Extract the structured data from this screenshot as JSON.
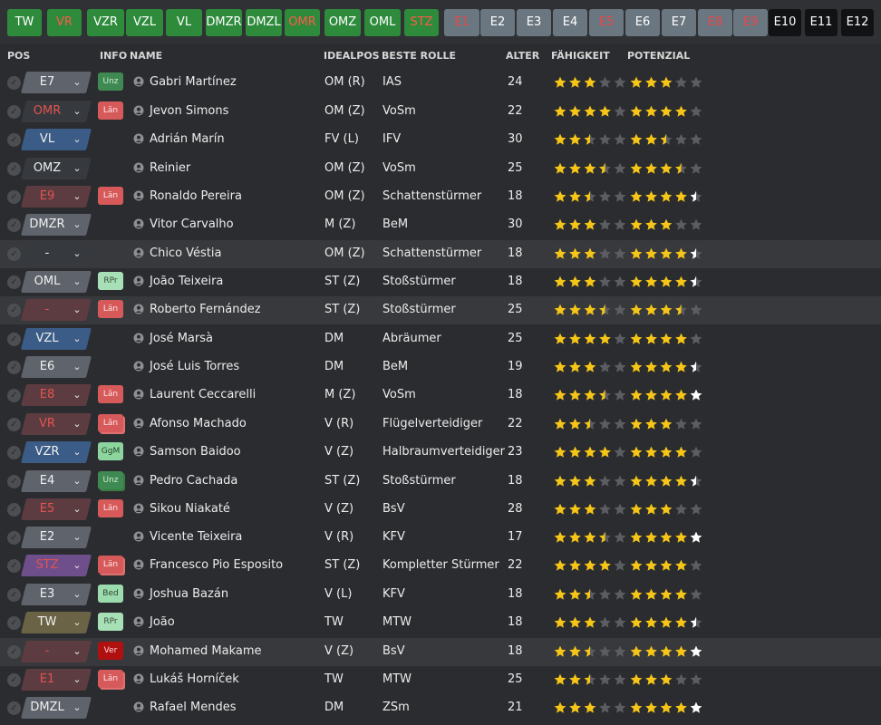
{
  "colors": {
    "star_full": "#f5c518",
    "star_white": "#ffffff",
    "star_empty": "#5b5d62"
  },
  "tabs": [
    {
      "label": "TW",
      "style": "green"
    },
    {
      "label": "VR",
      "style": "green-red"
    },
    {
      "label": "VZR",
      "style": "green"
    },
    {
      "label": "VZL",
      "style": "green"
    },
    {
      "label": "VL",
      "style": "green"
    },
    {
      "label": "DMZR",
      "style": "green"
    },
    {
      "label": "DMZL",
      "style": "green"
    },
    {
      "label": "OMR",
      "style": "green-red"
    },
    {
      "label": "OMZ",
      "style": "green"
    },
    {
      "label": "OML",
      "style": "green"
    },
    {
      "label": "STZ",
      "style": "green-red"
    },
    {
      "label": "E1",
      "style": "grey-red"
    },
    {
      "label": "E2",
      "style": "grey"
    },
    {
      "label": "E3",
      "style": "grey"
    },
    {
      "label": "E4",
      "style": "grey"
    },
    {
      "label": "E5",
      "style": "grey-red"
    },
    {
      "label": "E6",
      "style": "grey"
    },
    {
      "label": "E7",
      "style": "grey"
    },
    {
      "label": "E8",
      "style": "grey-red"
    },
    {
      "label": "E9",
      "style": "grey-red"
    },
    {
      "label": "E10",
      "style": "black"
    },
    {
      "label": "E11",
      "style": "black"
    },
    {
      "label": "E12",
      "style": "black"
    }
  ],
  "columns": {
    "pos": "POS",
    "info": "INFO",
    "name": "NAME",
    "idealpos": "IDEALPOS",
    "role": "BESTE ROLLE",
    "age": "ALTER",
    "ability": "FÄHIGKEIT",
    "potential": "POTENZIAL"
  },
  "players": [
    {
      "pos": "E7",
      "pos_style": "grey",
      "pos_red": false,
      "info": "Unz",
      "info_style": "unz",
      "name": "Gabri Martínez",
      "idealpos": "OM (R)",
      "role": "IAS",
      "age": "24",
      "ability": 3,
      "potential": 3,
      "pot_white": false
    },
    {
      "pos": "OMR",
      "pos_style": "dark",
      "pos_red": true,
      "info": "Län",
      "info_style": "lan",
      "name": "Jevon Simons",
      "idealpos": "OM (Z)",
      "role": "VoSm",
      "age": "22",
      "ability": 4,
      "potential": 4,
      "pot_white": false
    },
    {
      "pos": "VL",
      "pos_style": "blue",
      "pos_red": false,
      "info": "",
      "info_style": "",
      "name": "Adrián Marín",
      "idealpos": "FV (L)",
      "role": "IFV",
      "age": "30",
      "ability": 2.5,
      "potential": 2.5,
      "pot_white": false
    },
    {
      "pos": "OMZ",
      "pos_style": "dark",
      "pos_red": false,
      "info": "",
      "info_style": "",
      "name": "Reinier",
      "idealpos": "OM (Z)",
      "role": "VoSm",
      "age": "25",
      "ability": 3.5,
      "potential": 3.5,
      "pot_white": false
    },
    {
      "pos": "E9",
      "pos_style": "red",
      "pos_red": true,
      "info": "Län",
      "info_style": "lan",
      "name": "Ronaldo Pereira",
      "idealpos": "OM (Z)",
      "role": "Schattenstürmer",
      "age": "18",
      "ability": 2.5,
      "potential": 4.5,
      "pot_white": true
    },
    {
      "pos": "DMZR",
      "pos_style": "grey",
      "pos_red": false,
      "info": "",
      "info_style": "",
      "name": "Vitor Carvalho",
      "idealpos": "M (Z)",
      "role": "BeM",
      "age": "30",
      "ability": 3,
      "potential": 3,
      "pot_white": false
    },
    {
      "pos": "-",
      "pos_style": "dark",
      "pos_red": false,
      "info": "",
      "info_style": "",
      "name": "Chico Véstia",
      "idealpos": "OM (Z)",
      "role": "Schattenstürmer",
      "age": "18",
      "ability": 3,
      "potential": 4.5,
      "pot_white": true,
      "hl": true
    },
    {
      "pos": "OML",
      "pos_style": "grey",
      "pos_red": false,
      "info": "RPr",
      "info_style": "rpr",
      "name": "João Teixeira",
      "idealpos": "ST (Z)",
      "role": "Stoßstürmer",
      "age": "18",
      "ability": 3,
      "potential": 4.5,
      "pot_white": true
    },
    {
      "pos": "-",
      "pos_style": "red",
      "pos_red": true,
      "info": "Län",
      "info_style": "lan",
      "name": "Roberto Fernández",
      "idealpos": "ST (Z)",
      "role": "Stoßstürmer",
      "age": "25",
      "ability": 3.5,
      "potential": 3.5,
      "pot_white": false,
      "hl": true
    },
    {
      "pos": "VZL",
      "pos_style": "blue",
      "pos_red": false,
      "info": "",
      "info_style": "",
      "name": "José Marsà",
      "idealpos": "DM",
      "role": "Abräumer",
      "age": "25",
      "ability": 4,
      "potential": 4,
      "pot_white": false
    },
    {
      "pos": "E6",
      "pos_style": "grey",
      "pos_red": false,
      "info": "",
      "info_style": "",
      "name": "José Luis Torres",
      "idealpos": "DM",
      "role": "BeM",
      "age": "19",
      "ability": 3,
      "potential": 4.5,
      "pot_white": true
    },
    {
      "pos": "E8",
      "pos_style": "red",
      "pos_red": true,
      "info": "Län",
      "info_style": "lan",
      "name": "Laurent Ceccarelli",
      "idealpos": "M (Z)",
      "role": "VoSm",
      "age": "18",
      "ability": 3.5,
      "potential": 5,
      "pot_white": true
    },
    {
      "pos": "VR",
      "pos_style": "red",
      "pos_red": true,
      "info": "Län",
      "info_style": "lan-stack",
      "name": "Afonso Machado",
      "idealpos": "V (R)",
      "role": "Flügelverteidiger",
      "age": "22",
      "ability": 2.5,
      "potential": 3,
      "pot_white": false
    },
    {
      "pos": "VZR",
      "pos_style": "blue",
      "pos_red": false,
      "info": "GgM",
      "info_style": "ggm",
      "name": "Samson Baidoo",
      "idealpos": "V (Z)",
      "role": "Halbraumverteidiger",
      "age": "23",
      "ability": 4,
      "potential": 4,
      "pot_white": false
    },
    {
      "pos": "E4",
      "pos_style": "grey",
      "pos_red": false,
      "info": "Unz",
      "info_style": "unz-stack",
      "name": "Pedro Cachada",
      "idealpos": "ST (Z)",
      "role": "Stoßstürmer",
      "age": "18",
      "ability": 3,
      "potential": 4.5,
      "pot_white": true
    },
    {
      "pos": "E5",
      "pos_style": "red",
      "pos_red": true,
      "info": "Län",
      "info_style": "lan",
      "name": "Sikou Niakaté",
      "idealpos": "V (Z)",
      "role": "BsV",
      "age": "28",
      "ability": 3,
      "potential": 3,
      "pot_white": false
    },
    {
      "pos": "E2",
      "pos_style": "grey",
      "pos_red": false,
      "info": "",
      "info_style": "",
      "name": "Vicente Teixeira",
      "idealpos": "V (R)",
      "role": "KFV",
      "age": "17",
      "ability": 3.5,
      "potential": 5,
      "pot_white": true
    },
    {
      "pos": "STZ",
      "pos_style": "purple",
      "pos_red": true,
      "info": "Län",
      "info_style": "lan-stack",
      "name": "Francesco Pio Esposito",
      "idealpos": "ST (Z)",
      "role": "Kompletter Stürmer",
      "age": "22",
      "ability": 4,
      "potential": 4,
      "pot_white": false
    },
    {
      "pos": "E3",
      "pos_style": "grey",
      "pos_red": false,
      "info": "Bed",
      "info_style": "bed",
      "name": "Joshua Bazán",
      "idealpos": "V (L)",
      "role": "KFV",
      "age": "18",
      "ability": 2.5,
      "potential": 4,
      "pot_white": true
    },
    {
      "pos": "TW",
      "pos_style": "olive",
      "pos_red": false,
      "info": "RPr",
      "info_style": "rpr",
      "name": "João",
      "idealpos": "TW",
      "role": "MTW",
      "age": "18",
      "ability": 3,
      "potential": 4.5,
      "pot_white": true
    },
    {
      "pos": "-",
      "pos_style": "red",
      "pos_red": true,
      "info": "Ver",
      "info_style": "ver",
      "name": "Mohamed Makame",
      "idealpos": "V (Z)",
      "role": "BsV",
      "age": "18",
      "ability": 2.5,
      "potential": 5,
      "pot_white": true,
      "hl": true
    },
    {
      "pos": "E1",
      "pos_style": "red",
      "pos_red": true,
      "info": "Län",
      "info_style": "lan-stack",
      "name": "Lukáš Horníček",
      "idealpos": "TW",
      "role": "MTW",
      "age": "25",
      "ability": 2.5,
      "potential": 3,
      "pot_white": false
    },
    {
      "pos": "DMZL",
      "pos_style": "grey",
      "pos_red": false,
      "info": "",
      "info_style": "",
      "name": "Rafael Mendes",
      "idealpos": "DM",
      "role": "ZSm",
      "age": "21",
      "ability": 3,
      "potential": 5,
      "pot_white": true
    }
  ]
}
